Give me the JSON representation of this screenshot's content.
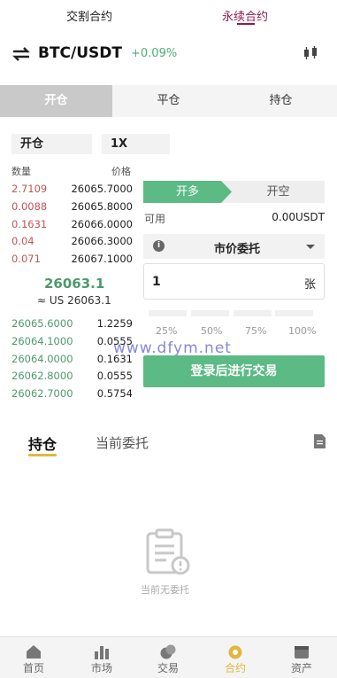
{
  "top_tabs": {
    "delivery": "交割合约",
    "perpetual": "永续合约"
  },
  "pair": {
    "symbol": "BTC/USDT",
    "change": "+0.09%"
  },
  "mode_tabs": [
    "开仓",
    "平仓",
    "持仓"
  ],
  "selectors": {
    "margin_mode": "开仓",
    "leverage": "1X"
  },
  "orderbook": {
    "qty_header": "数量",
    "price_header": "价格",
    "asks": [
      {
        "qty": "2.7109",
        "price": "26065.7000"
      },
      {
        "qty": "0.0088",
        "price": "26065.8000"
      },
      {
        "qty": "0.1631",
        "price": "26066.0000"
      },
      {
        "qty": "0.04",
        "price": "26066.3000"
      },
      {
        "qty": "0.071",
        "price": "26067.1000"
      }
    ],
    "last_price": "26063.1",
    "last_usd": "≈ US 26063.1",
    "bids": [
      {
        "price": "26065.6000",
        "qty": "1.2259"
      },
      {
        "price": "26064.1000",
        "qty": "0.0555"
      },
      {
        "price": "26064.0000",
        "qty": "0.1631"
      },
      {
        "price": "26062.8000",
        "qty": "0.0555"
      },
      {
        "price": "26062.7000",
        "qty": "0.5754"
      }
    ]
  },
  "trade_panel": {
    "buy_label": "开多",
    "sell_label": "开空",
    "available_label": "可用",
    "available_value": "0.00USDT",
    "order_type": "市价委托",
    "qty_value": "1",
    "qty_unit": "张",
    "percent_options": [
      "25%",
      "50%",
      "75%",
      "100%"
    ],
    "login_button": "登录后进行交易",
    "watermark": "www.dfym.net"
  },
  "position_tabs": {
    "positions": "持仓",
    "open_orders": "当前委托",
    "empty_text": "当前无委托"
  },
  "tabbar": [
    {
      "label": "首页",
      "icon": "home-icon"
    },
    {
      "label": "市场",
      "icon": "market-icon"
    },
    {
      "label": "交易",
      "icon": "trade-icon"
    },
    {
      "label": "合约",
      "icon": "contract-icon"
    },
    {
      "label": "资产",
      "icon": "wallet-icon"
    }
  ],
  "colors": {
    "accent_green": "#5cba85",
    "ask_red": "#c05555",
    "active_tab": "#8a1c4c",
    "tabbar_active": "#e0b83e"
  }
}
